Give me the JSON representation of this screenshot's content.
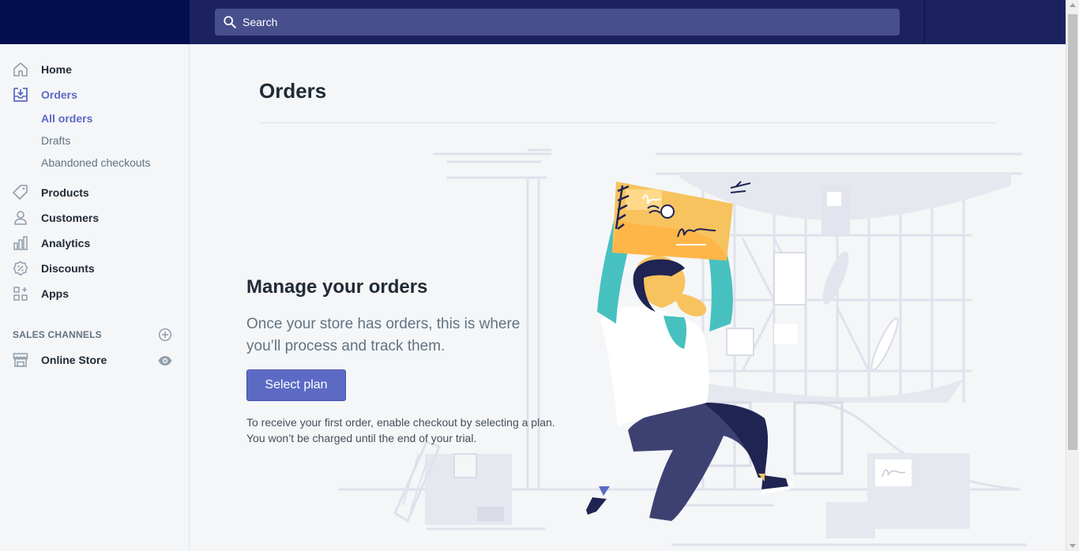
{
  "search": {
    "placeholder": "Search"
  },
  "sidebar": {
    "items": [
      {
        "label": "Home",
        "icon": "home-icon"
      },
      {
        "label": "Orders",
        "icon": "orders-icon",
        "active": true
      },
      {
        "label": "Products",
        "icon": "tag-icon"
      },
      {
        "label": "Customers",
        "icon": "person-icon"
      },
      {
        "label": "Analytics",
        "icon": "bar-chart-icon"
      },
      {
        "label": "Discounts",
        "icon": "discount-icon"
      },
      {
        "label": "Apps",
        "icon": "apps-icon"
      }
    ],
    "orders_sub": [
      {
        "label": "All orders",
        "active": true
      },
      {
        "label": "Drafts"
      },
      {
        "label": "Abandoned checkouts"
      }
    ],
    "sales_channels_heading": "SALES CHANNELS",
    "channels": [
      {
        "label": "Online Store",
        "icon": "store-icon"
      }
    ]
  },
  "page": {
    "title": "Orders"
  },
  "empty_state": {
    "heading": "Manage your orders",
    "description": "Once your store has orders, this is where you’ll process and track them.",
    "button_label": "Select plan",
    "footnote_line1": "To receive your first order, enable checkout by selecting a plan.",
    "footnote_line2": "You won’t be charged until the end of your trial."
  },
  "colors": {
    "topbar": "#1c2260",
    "brand_area": "#020e4d",
    "search_bg": "#47508c",
    "accent": "#5c6ac4",
    "background": "#f4f6f8"
  }
}
